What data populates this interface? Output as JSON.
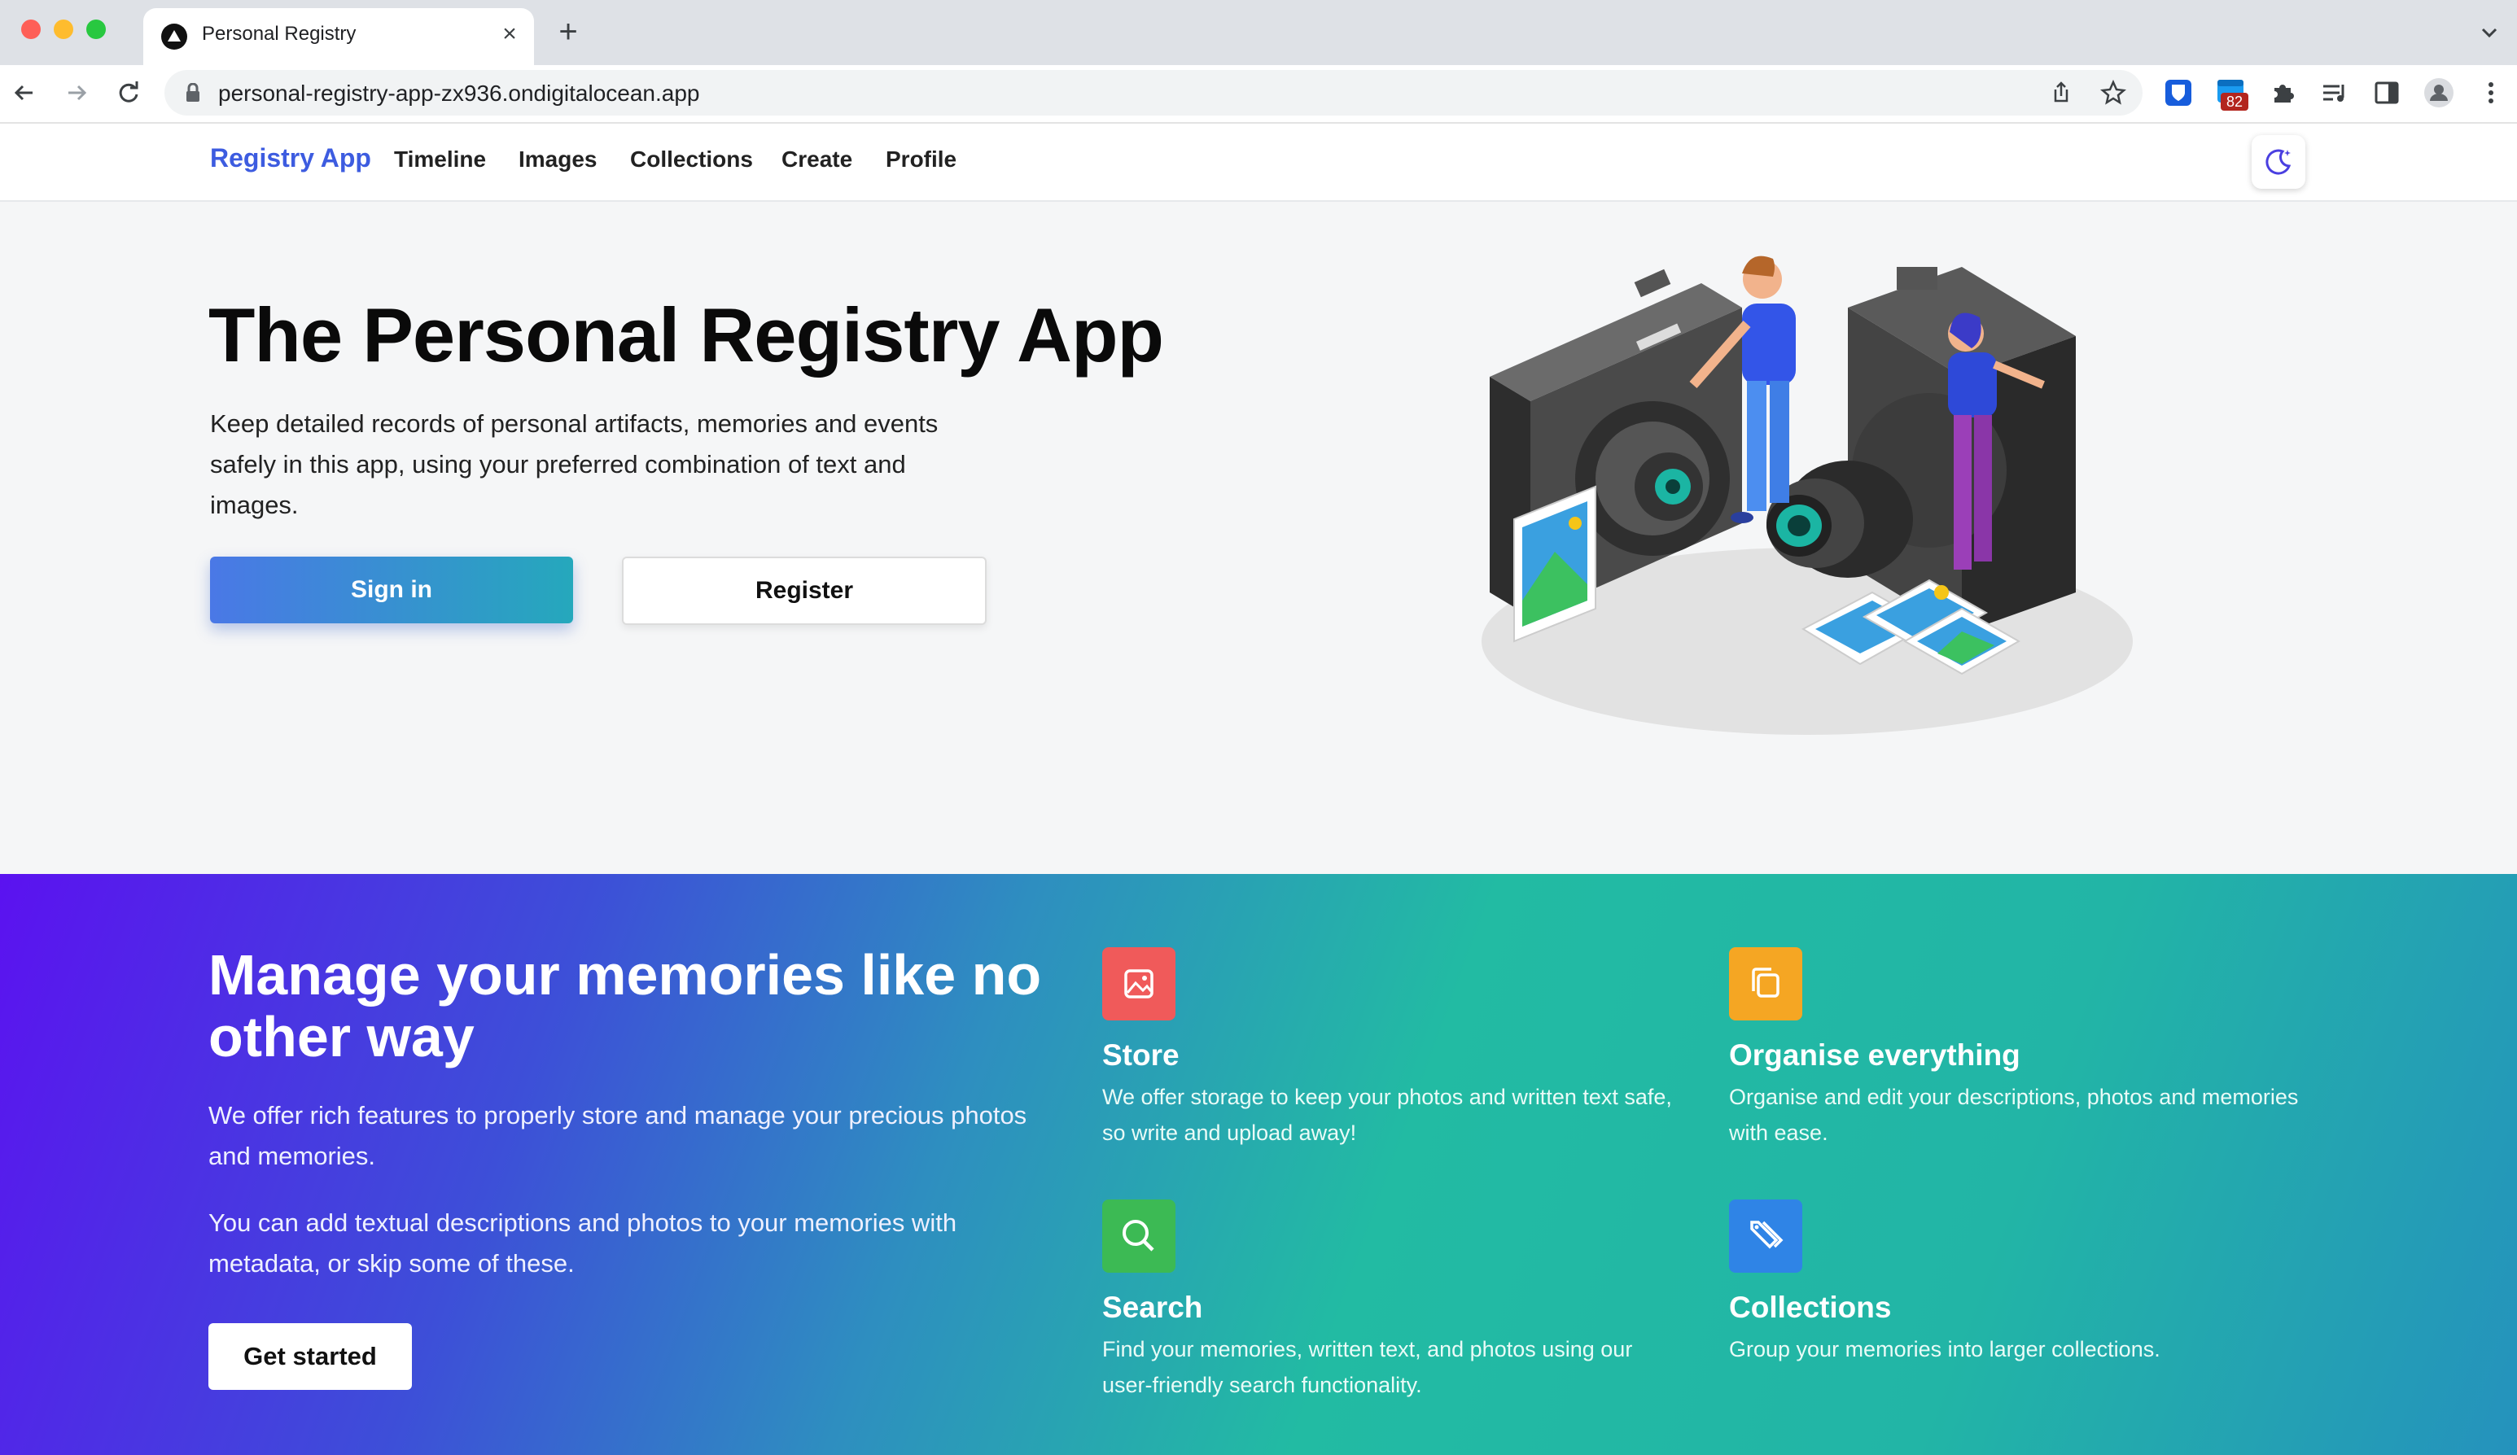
{
  "browser": {
    "tab_title": "Personal Registry",
    "url": "personal-registry-app-zx936.ondigitalocean.app",
    "extension_badge": "82"
  },
  "site": {
    "brand": "Registry App",
    "nav": [
      "Timeline",
      "Images",
      "Collections",
      "Create",
      "Profile"
    ]
  },
  "hero": {
    "title": "The Personal Registry App",
    "description": "Keep detailed records of personal artifacts, memories and events safely in this app, using your preferred combination of text and images.",
    "signin_label": "Sign in",
    "register_label": "Register"
  },
  "features": {
    "title": "Manage your memories like no other way",
    "paragraph1": "We offer rich features to properly store and manage your precious photos and memories.",
    "paragraph2": "You can add textual descriptions and photos to your memories with metadata, or skip some of these.",
    "cta_label": "Get started",
    "items": [
      {
        "name": "Store",
        "description": "We offer storage to keep your photos and written text safe, so write and upload away!",
        "icon": "image-icon",
        "color": "#f05a5a"
      },
      {
        "name": "Organise everything",
        "description": "Organise and edit your descriptions, photos and memories with ease.",
        "icon": "copy-icon",
        "color": "#f5a623"
      },
      {
        "name": "Search",
        "description": "Find your memories, written text, and photos using our user-friendly search functionality.",
        "icon": "search-icon",
        "color": "#3cba54"
      },
      {
        "name": "Collections",
        "description": "Group your memories into larger collections.",
        "icon": "tags-icon",
        "color": "#2f84e6"
      }
    ]
  },
  "colors": {
    "brand": "#3d5ce0",
    "gradient_start": "#5b12f0",
    "gradient_end": "#22bba3"
  }
}
